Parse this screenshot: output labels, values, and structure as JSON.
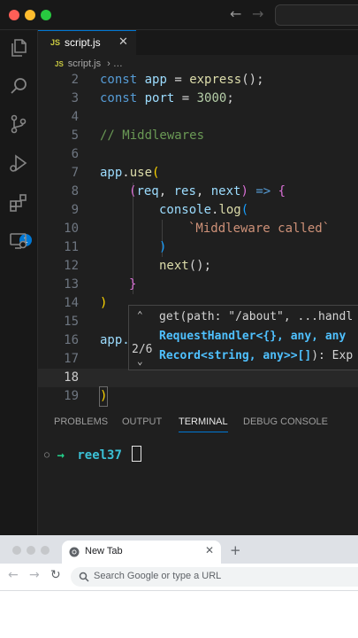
{
  "editor": {
    "tab": {
      "file_icon": "JS",
      "filename": "script.js",
      "close": "✕"
    },
    "breadcrumb": {
      "file_icon": "JS",
      "file": "script.js",
      "rest": "…"
    },
    "lines": [
      {
        "n": "2"
      },
      {
        "n": "3"
      },
      {
        "n": "4"
      },
      {
        "n": "5"
      },
      {
        "n": "6"
      },
      {
        "n": "7"
      },
      {
        "n": "8"
      },
      {
        "n": "9"
      },
      {
        "n": "10"
      },
      {
        "n": "11"
      },
      {
        "n": "12"
      },
      {
        "n": "13"
      },
      {
        "n": "14"
      },
      {
        "n": "15"
      },
      {
        "n": "16"
      },
      {
        "n": "17"
      },
      {
        "n": "18"
      },
      {
        "n": "19"
      }
    ],
    "code": {
      "l2": [
        "const",
        "app",
        "=",
        "express",
        "();"
      ],
      "l3": [
        "const",
        "port",
        "=",
        "3000",
        ";"
      ],
      "l5": "// Middlewares",
      "l7": [
        "app",
        ".",
        "use",
        "("
      ],
      "l8": [
        "(",
        "req",
        ", ",
        "res",
        ", ",
        "next",
        ")",
        " => ",
        "{"
      ],
      "l9": [
        "console",
        ".",
        "log",
        "("
      ],
      "l10": "`Middleware called`",
      "l11": ")",
      "l12": [
        "next",
        "()",
        ";"
      ],
      "l13": "}",
      "l14": ")",
      "l16": "app."
    },
    "activity_badge": "1"
  },
  "hover": {
    "count": "2/6",
    "line1": "get(path: \"/about\", ...handl",
    "line2": "RequestHandler<{}, any, any",
    "line3_a": "Record<string, any>>[]",
    "line3_b": "): Exp"
  },
  "panel": {
    "tabs": [
      "PROBLEMS",
      "OUTPUT",
      "TERMINAL",
      "DEBUG CONSOLE"
    ],
    "active_tab": "TERMINAL",
    "terminal": {
      "prompt_arrow": "→",
      "dir": "reel37"
    }
  },
  "browser": {
    "tab_title": "New Tab",
    "tab_close": "✕",
    "new_tab": "+",
    "omnibox_placeholder": "Search Google or type a URL"
  },
  "colors": {
    "editor_bg": "#1f1f1f",
    "accent": "#0078d4",
    "keyword": "#569cd6",
    "variable": "#9cdcfe",
    "function": "#dcdcaa",
    "string": "#ce9178",
    "comment": "#6a9955",
    "terminal_dir": "#3bc0d6",
    "terminal_arrow": "#23d18b"
  },
  "icons": {
    "window": [
      "close-dot",
      "minimize-dot",
      "zoom-dot"
    ],
    "nav": [
      "back-arrow-icon",
      "forward-arrow-icon"
    ],
    "activity": [
      "explorer-icon",
      "search-icon",
      "source-control-icon",
      "run-debug-icon",
      "extensions-icon",
      "remote-explorer-icon"
    ]
  }
}
